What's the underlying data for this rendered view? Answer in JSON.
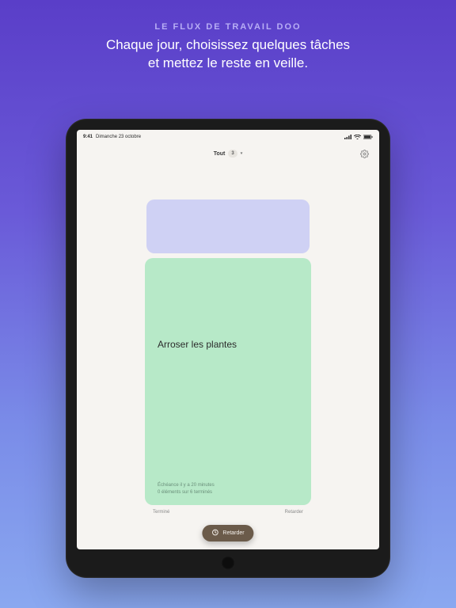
{
  "promo": {
    "eyebrow": "LE FLUX DE TRAVAIL DOO",
    "headline_line1": "Chaque jour, choisissez quelques tâches",
    "headline_line2": "et mettez le reste en veille."
  },
  "status_bar": {
    "time": "9:41",
    "date": "Dimanche 23 octobre"
  },
  "header": {
    "filter_label": "Tout",
    "filter_count": "3",
    "chevron": "▾"
  },
  "task": {
    "title": "Arroser les plantes",
    "due_text": "Échéance il y a 20 minutes",
    "progress_text": "0 éléments sur 6 terminés"
  },
  "card_actions": {
    "left": "Terminé",
    "right": "Retarder"
  },
  "bottom_pill": {
    "label": "Retarder"
  }
}
